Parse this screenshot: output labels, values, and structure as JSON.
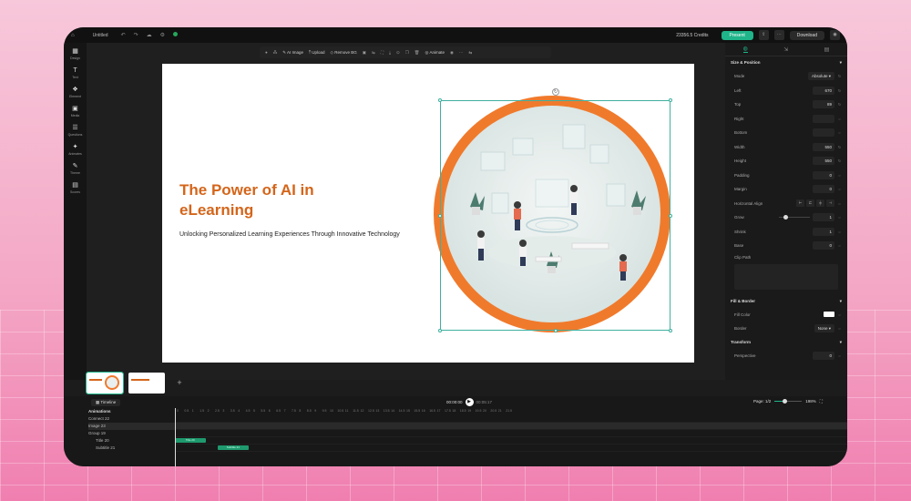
{
  "topbar": {
    "document_title": "Untitled",
    "credits": "23356.5 Credits",
    "present_label": "Present",
    "download_label": "Download"
  },
  "sidebar": {
    "items": [
      {
        "label": "Design",
        "icon": "design-icon",
        "glyph": "▦"
      },
      {
        "label": "Text",
        "icon": "text-icon",
        "glyph": "T"
      },
      {
        "label": "Element",
        "icon": "element-icon",
        "glyph": "❖"
      },
      {
        "label": "Media",
        "icon": "media-icon",
        "glyph": "▣"
      },
      {
        "label": "Questions",
        "icon": "questions-icon",
        "glyph": "☰"
      },
      {
        "label": "Animates",
        "icon": "animates-icon",
        "glyph": "✦"
      },
      {
        "label": "Theme",
        "icon": "theme-icon",
        "glyph": "✎"
      },
      {
        "label": "Scores",
        "icon": "scores-icon",
        "glyph": "▤"
      }
    ]
  },
  "toolbar": {
    "ai_image": "AI Image",
    "upload": "Upload",
    "remove_bg": "Remove BG",
    "animate": "Animate"
  },
  "slide": {
    "title": "The Power of AI in eLearning",
    "subtitle": "Unlocking Personalized Learning Experiences Through Innovative Technology"
  },
  "properties": {
    "section_size": "Size & Position",
    "mode_label": "Mode",
    "mode_value": "Absolute",
    "left_label": "Left",
    "left_value": "670",
    "top_label": "Top",
    "top_value": "89",
    "right_label": "Right",
    "right_value": "",
    "bottom_label": "Bottom",
    "bottom_value": "",
    "width_label": "Width",
    "width_value": "550",
    "height_label": "Height",
    "height_value": "550",
    "padding_label": "Padding",
    "padding_value": "0",
    "margin_label": "Margin",
    "margin_value": "0",
    "halign_label": "Horizontal Align",
    "grow_label": "Grow",
    "grow_value": "1",
    "shrink_label": "Shrink",
    "shrink_value": "1",
    "base_label": "Base",
    "base_value": "0",
    "clip_label": "Clip Path",
    "section_fill": "Fill & Border",
    "fill_label": "Fill Color",
    "border_label": "Border",
    "border_value": "None",
    "section_transform": "Transform",
    "perspective_label": "Perspective",
    "perspective_value": "0"
  },
  "timeline": {
    "timeline_label": "Timeline",
    "current_time": "00:00:00",
    "total_time": "00:05:17",
    "page_label": "Page: 1/2",
    "zoom": "198%",
    "header": "Animations",
    "layers": [
      "Connect 22",
      "Image 23",
      "Group 19",
      "Title 20",
      "Subtitle 21"
    ],
    "bars": [
      {
        "label": "Title 20",
        "start": 0,
        "end": 2
      },
      {
        "label": "Subtitle 21",
        "start": 2.8,
        "end": 4.8
      }
    ],
    "ruler": [
      "0",
      "0.5",
      "1",
      "1.5",
      "2",
      "2.5",
      "3",
      "3.5",
      "4",
      "4.5",
      "5",
      "5.5",
      "6",
      "6.5",
      "7",
      "7.5",
      "8",
      "8.5",
      "9",
      "9.5",
      "10",
      "10.5",
      "11",
      "11.5",
      "12",
      "12.5",
      "13",
      "13.5",
      "14",
      "14.5",
      "15",
      "15.5",
      "16",
      "16.5",
      "17",
      "17.5",
      "18",
      "18.5",
      "19",
      "19.5",
      "20",
      "20.5",
      "21",
      "21.5"
    ]
  },
  "colors": {
    "accent": "#1fb48a",
    "title_orange": "#d4651a",
    "ring_orange": "#f07a2c"
  }
}
